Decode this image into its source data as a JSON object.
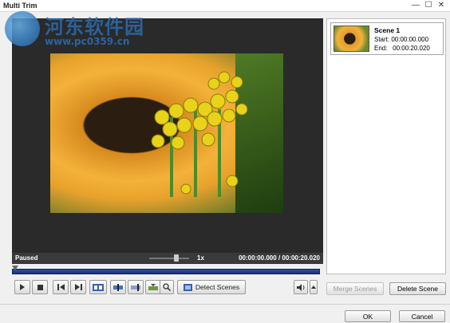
{
  "window": {
    "title": "Multi Trim",
    "controls": [
      "—",
      "☐",
      "✕"
    ]
  },
  "watermark": {
    "site_name": "河东软件园",
    "url": "www.pc0359.cn"
  },
  "player": {
    "status": "Paused",
    "speed": "1x",
    "current_time": "00:00:00.000",
    "total_time": "00:00:20.020",
    "separator": "/",
    "seek_progress": 0.0
  },
  "toolbar": {
    "play_icon": "play-icon",
    "stop_icon": "stop-icon",
    "prev_icon": "previous-frame-icon",
    "next_icon": "next-frame-icon",
    "detect_scenes_label": "Detect Scenes",
    "merge_scenes_label": "Merge Scenes",
    "delete_scene_label": "Delete Scene"
  },
  "scenes": [
    {
      "name": "Scene 1",
      "start": "Start: 00:00:00.000",
      "end": "End:   00:00:20.020"
    }
  ],
  "dialog": {
    "ok_label": "OK",
    "cancel_label": "Cancel"
  },
  "colors": {
    "seek_bar": "#2f4ea6",
    "player_bg": "#2a2a2a"
  }
}
